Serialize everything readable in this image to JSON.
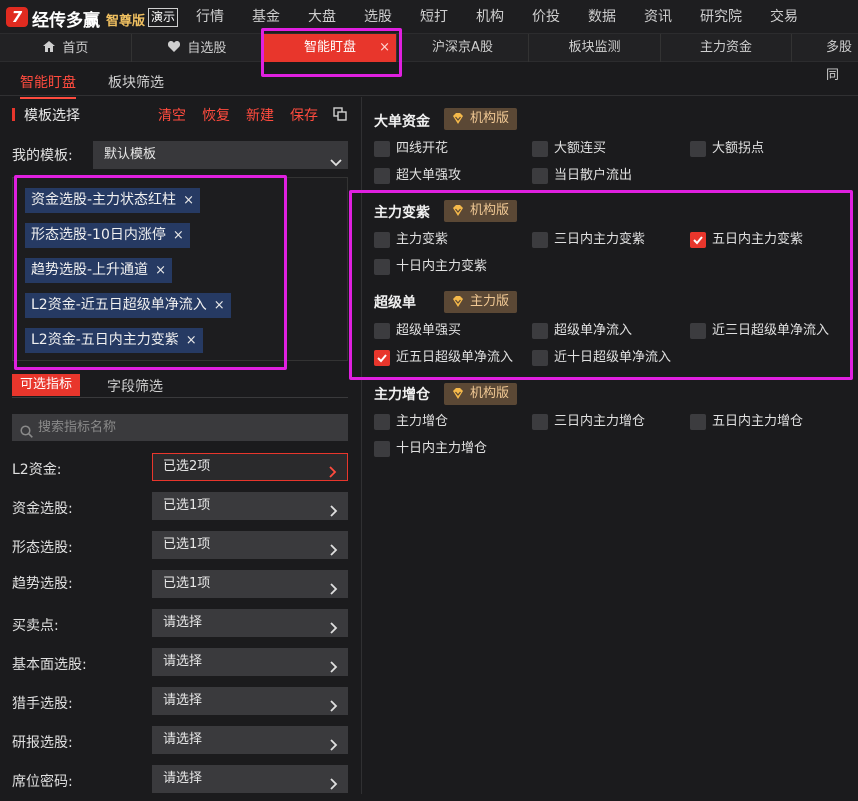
{
  "app": {
    "logo_letter": "7",
    "brand": "经传多赢",
    "edition": "智尊版",
    "demo": "演示"
  },
  "menu": [
    "行情",
    "基金",
    "大盘",
    "选股",
    "短打",
    "机构",
    "价投",
    "数据",
    "资讯",
    "研究院",
    "交易"
  ],
  "tabs": [
    {
      "label": "首页",
      "icon": "home-icon"
    },
    {
      "label": "自选股",
      "icon": "heart-icon"
    },
    {
      "label": "智能盯盘",
      "active": true,
      "close": "×"
    },
    {
      "label": "沪深京A股"
    },
    {
      "label": "板块监测"
    },
    {
      "label": "主力资金"
    },
    {
      "label": "多股同"
    }
  ],
  "subtabs": [
    "智能盯盘",
    "板块筛选"
  ],
  "template": {
    "title": "模板选择",
    "actions": [
      "清空",
      "恢复",
      "新建",
      "保存"
    ],
    "my_label": "我的模板:",
    "selected": "默认模板",
    "chips": [
      "资金选股-主力状态红柱",
      "形态选股-10日内涨停",
      "趋势选股-上升通道",
      "L2资金-近五日超级单净流入",
      "L2资金-五日内主力变紫"
    ],
    "chip_close": "×"
  },
  "indicators": {
    "tab_active": "可选指标",
    "tab_other": "字段筛选",
    "search_placeholder": "搜索指标名称",
    "rows": [
      {
        "label": "L2资金:",
        "value": "已选2项",
        "selected": true
      },
      {
        "label": "资金选股:",
        "value": "已选1项"
      },
      {
        "label": "形态选股:",
        "value": "已选1项"
      },
      {
        "label": "趋势选股:",
        "value": "已选1项"
      },
      {
        "label": "买卖点:",
        "value": "请选择"
      },
      {
        "label": "基本面选股:",
        "value": "请选择"
      },
      {
        "label": "猎手选股:",
        "value": "请选择"
      },
      {
        "label": "研报选股:",
        "value": "请选择"
      },
      {
        "label": "席位密码:",
        "value": "请选择"
      }
    ]
  },
  "sections": [
    {
      "title": "大单资金",
      "badge": "机构版",
      "items": [
        {
          "label": "四线开花",
          "checked": false
        },
        {
          "label": "大额连买",
          "checked": false
        },
        {
          "label": "大额拐点",
          "checked": false
        },
        {
          "label": "超大单强攻",
          "checked": false
        },
        {
          "label": "当日散户流出",
          "checked": false
        }
      ]
    },
    {
      "title": "主力变紫",
      "badge": "机构版",
      "items": [
        {
          "label": "主力变紫",
          "checked": false
        },
        {
          "label": "三日内主力变紫",
          "checked": false
        },
        {
          "label": "五日内主力变紫",
          "checked": true
        },
        {
          "label": "十日内主力变紫",
          "checked": false
        }
      ]
    },
    {
      "title": "超级单",
      "badge": "主力版",
      "items": [
        {
          "label": "超级单强买",
          "checked": false
        },
        {
          "label": "超级单净流入",
          "checked": false
        },
        {
          "label": "近三日超级单净流入",
          "checked": false
        },
        {
          "label": "近五日超级单净流入",
          "checked": true
        },
        {
          "label": "近十日超级单净流入",
          "checked": false
        }
      ]
    },
    {
      "title": "主力增仓",
      "badge": "机构版",
      "items": [
        {
          "label": "主力增仓",
          "checked": false
        },
        {
          "label": "三日内主力增仓",
          "checked": false
        },
        {
          "label": "五日内主力增仓",
          "checked": false
        },
        {
          "label": "十日内主力增仓",
          "checked": false
        }
      ]
    }
  ],
  "colors": {
    "accent": "#e8362c",
    "highlight": "#e020e0",
    "chip": "#263a63",
    "badge": "#5b4835"
  }
}
